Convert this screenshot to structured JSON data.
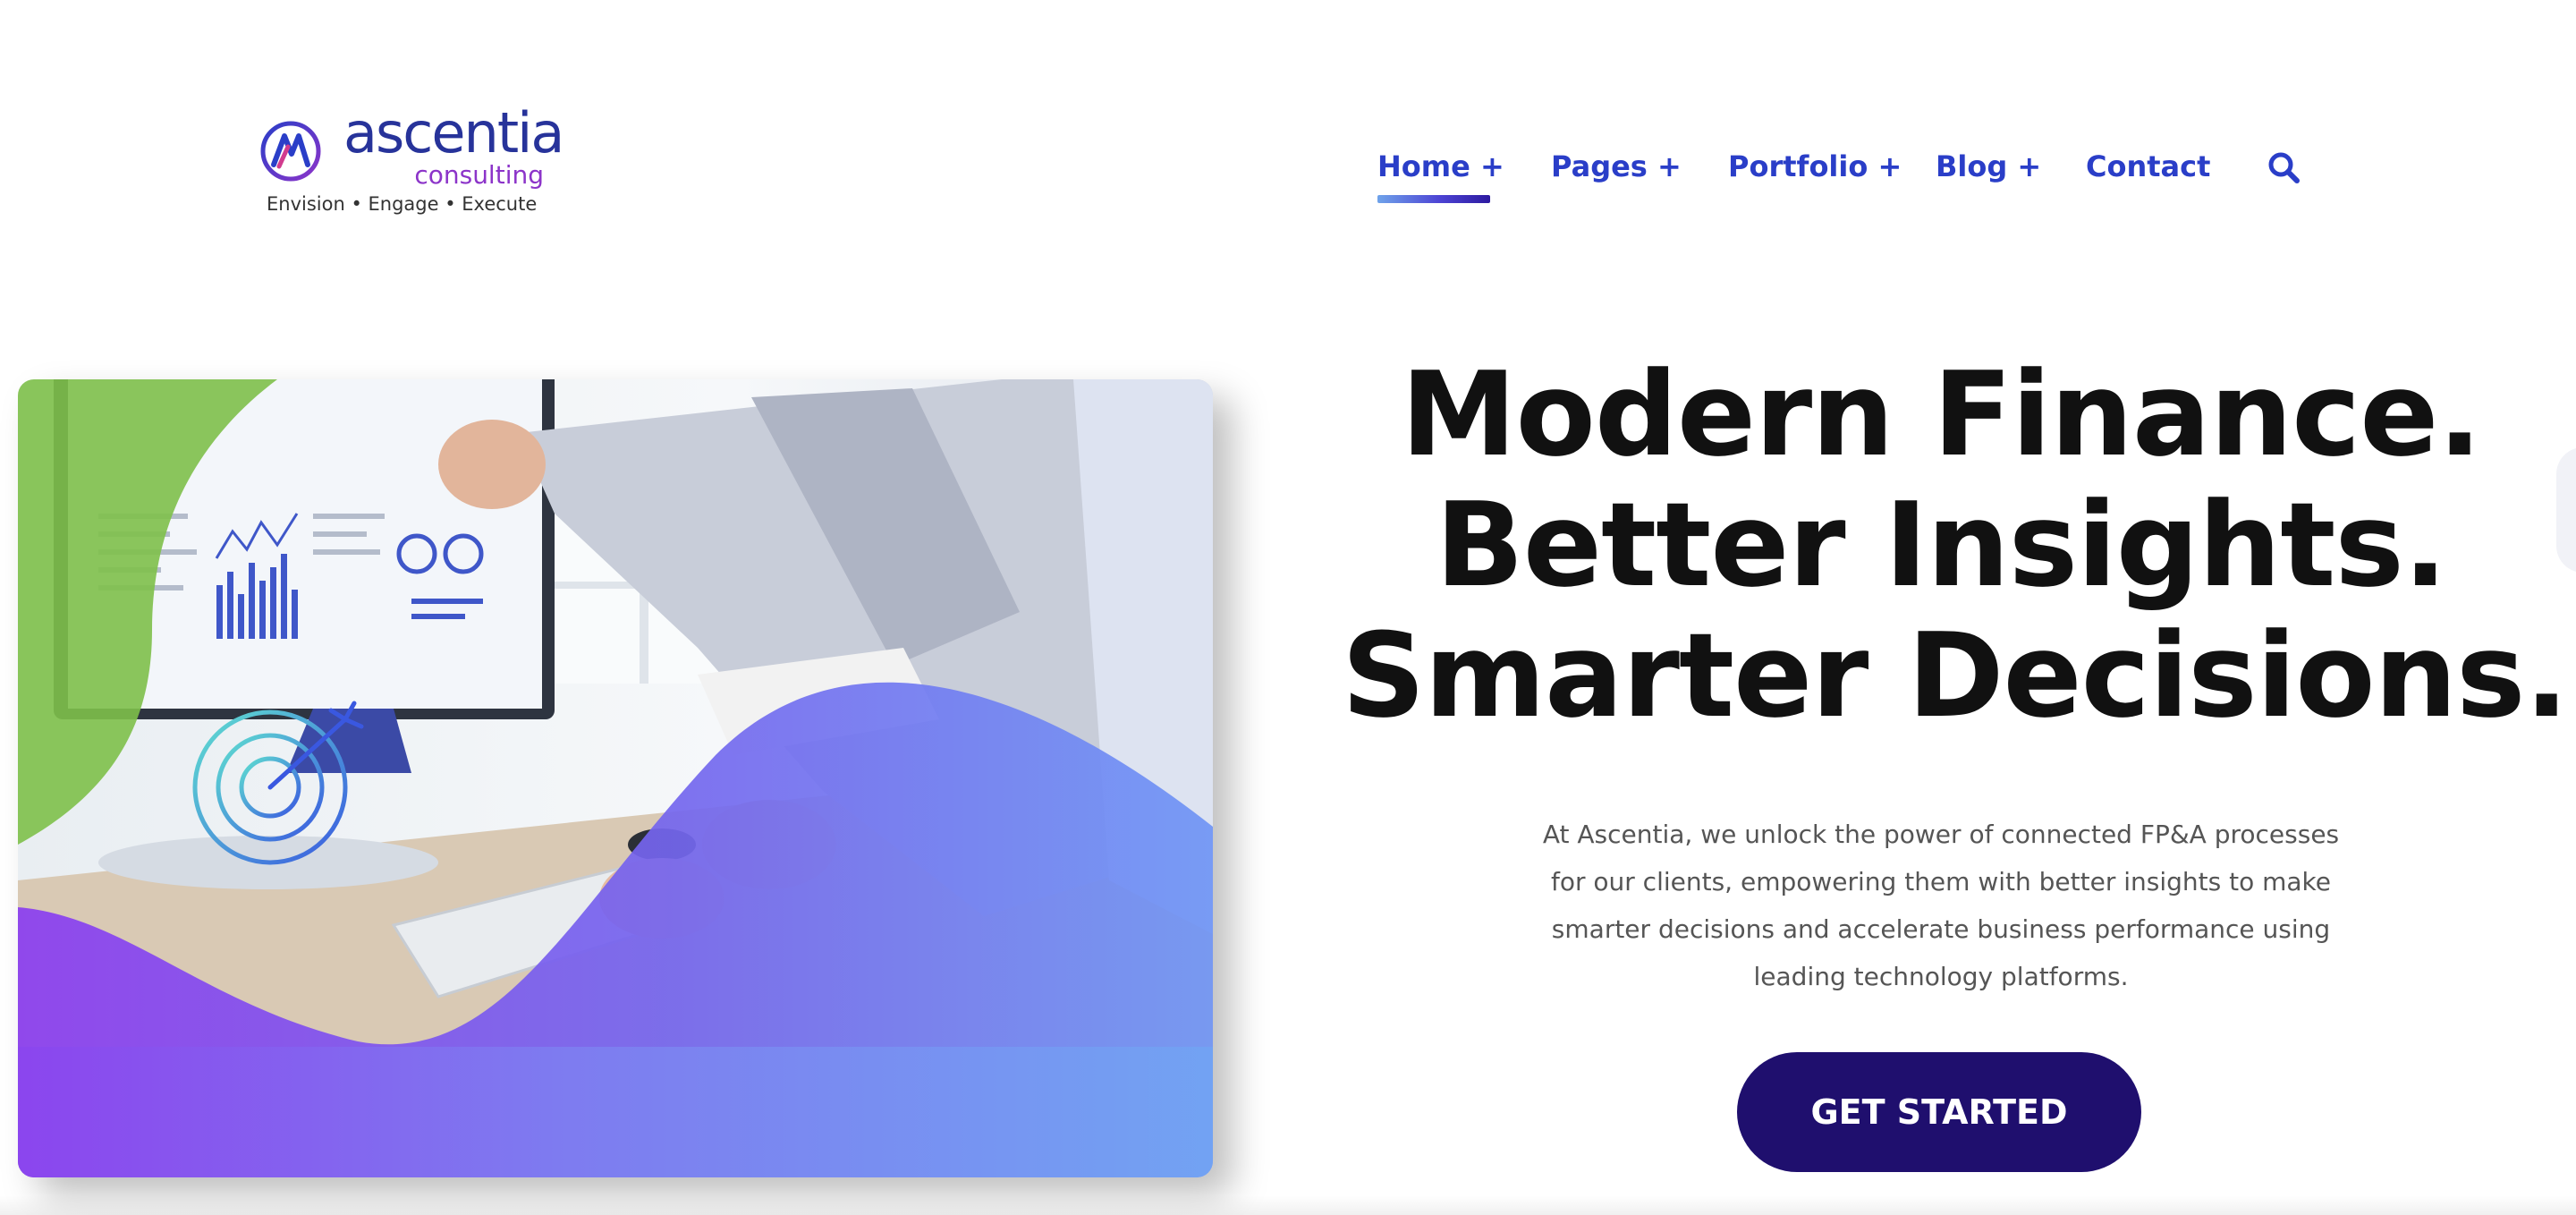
{
  "header": {
    "logo": {
      "wordmark": "ascentia",
      "subtitle": "consulting",
      "tagline": "Envision • Engage • Execute",
      "icon": "ascentia-logo-mark"
    },
    "nav": {
      "items": [
        {
          "label": "Home +",
          "active": true
        },
        {
          "label": "Pages +"
        },
        {
          "label": "Portfolio +"
        },
        {
          "label": "Blog +"
        },
        {
          "label": "Contact"
        }
      ],
      "search_icon": "search-icon"
    }
  },
  "hero": {
    "headline": {
      "line1": "Modern Finance.",
      "line2": "Better Insights.",
      "line3": "Smarter Decisions."
    },
    "description": "At Ascentia, we unlock the power of connected FP&A processes for our clients, empowering them with better insights to make smarter decisions and accelerate business performance using leading technology platforms.",
    "cta_label": "GET STARTED",
    "image": {
      "subject": "people reviewing financial dashboards on a computer monitor",
      "overlay_icon": "target-icon"
    }
  },
  "colors": {
    "nav_text": "#2a3ec8",
    "headline": "#111111",
    "body_text": "#555555",
    "cta_background": "#1f0f6e",
    "cta_text": "#ffffff",
    "logo_primary": "#27339a",
    "logo_secondary": "#8c34c9",
    "overlay_green": "#7ec04a",
    "overlay_purple": "#7b3cf0",
    "overlay_blue": "#6f95f5"
  }
}
